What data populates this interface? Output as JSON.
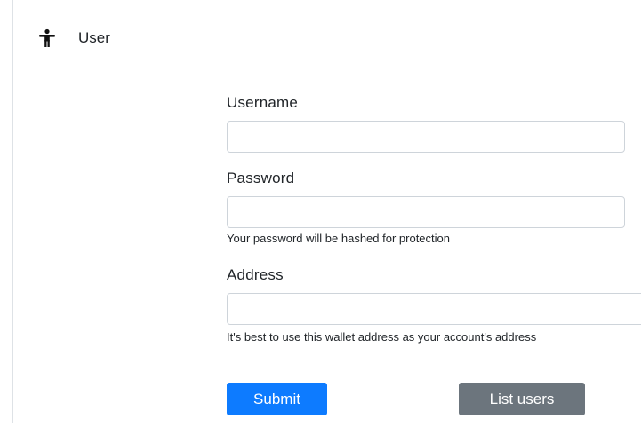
{
  "header": {
    "title": "User",
    "icon": "accessibility-person-icon"
  },
  "form": {
    "username_label": "Username",
    "username_value": "",
    "password_label": "Password",
    "password_value": "",
    "password_help": "Your password will be hashed for protection",
    "address_label": "Address",
    "address_value": "",
    "address_help": "It's best to use this wallet address as your account's address"
  },
  "buttons": {
    "submit_label": "Submit",
    "list_users_label": "List users"
  },
  "colors": {
    "primary": "#0d7bff",
    "secondary": "#6c757d",
    "input_border": "#ced4da"
  }
}
